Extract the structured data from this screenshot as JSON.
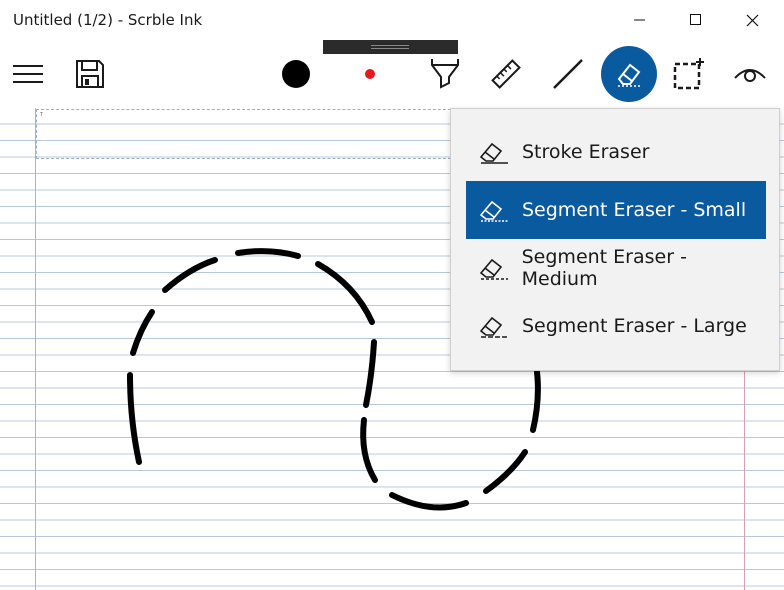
{
  "window": {
    "title": "Untitled (1/2) - Scrble Ink",
    "controls": [
      "minimize",
      "maximize",
      "close"
    ]
  },
  "toolbar": {
    "left_tools": [
      {
        "name": "menu",
        "icon": "hamburger-icon"
      },
      {
        "name": "save",
        "icon": "floppy-disk-icon"
      }
    ],
    "tools": [
      {
        "name": "pen-color",
        "icon": "black-circle-icon",
        "color": "#000000"
      },
      {
        "name": "pen-size",
        "icon": "red-dot-icon",
        "color": "#e21b1b"
      },
      {
        "name": "highlighter",
        "icon": "highlighter-icon"
      },
      {
        "name": "ruler",
        "icon": "ruler-icon"
      },
      {
        "name": "line",
        "icon": "line-icon"
      },
      {
        "name": "eraser",
        "icon": "eraser-icon",
        "active": true
      },
      {
        "name": "selection",
        "icon": "lasso-select-icon"
      },
      {
        "name": "view",
        "icon": "eye-icon"
      }
    ],
    "accent_color": "#0a5aa0"
  },
  "canvas": {
    "paper": "lined",
    "line_color": "#b8c8dc",
    "margin_color": "#d9a0b0"
  },
  "eraser_menu": {
    "items": [
      {
        "label": "Stroke Eraser",
        "selected": false
      },
      {
        "label": "Segment Eraser - Small",
        "selected": true
      },
      {
        "label": "Segment Eraser - Medium",
        "selected": false
      },
      {
        "label": "Segment Eraser - Large",
        "selected": false
      }
    ]
  }
}
